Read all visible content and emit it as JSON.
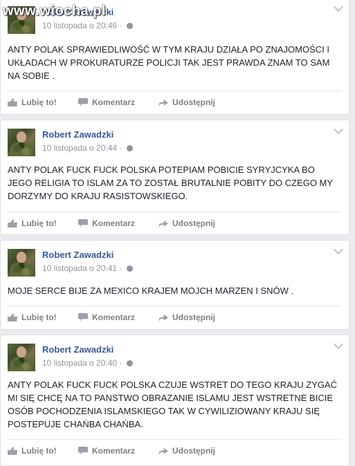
{
  "watermark": "www.wiocha.pl",
  "actions": {
    "like": "Lubię to!",
    "comment": "Komentarz",
    "share": "Udostępnij"
  },
  "posts": [
    {
      "author": "Robert Zawadzki",
      "time": "10 listopada o 20:46",
      "text": "ANTY POLAK SPRAWIEDLIWOŚĆ W TYM KRAJU DZIAŁA PO ZNAJOMOŚCI I UKŁADACH W PROKURATURZE POLICJI TAK JEST PRAWDA ZNAM TO SAM NA SOBIE ."
    },
    {
      "author": "Robert Zawadzki",
      "time": "10 listopada o 20:44",
      "text": "ANTY POLAK FUCK FUCK POLSKA POTEPIAM POBICIE SYRYJCYKA BO JEGO RELIGIA TO ISLAM ZA TO ZOSTAŁ BRUTALNIE POBITY DO CZEGO MY DORZYMY DO KRAJU RASISTOWSKIEGO."
    },
    {
      "author": "Robert Zawadzki",
      "time": "10 listopada o 20:41",
      "text": "MOJE SERCE BIJE ZA MEXICO KRAJEM MOJCH MARZEN I SNÓW ."
    },
    {
      "author": "Robert Zawadzki",
      "time": "10 listopada o 20:40",
      "text": "ANTY POLAK FUCK FUCK POLSKA CZUJE WSTRET DO TEGO KRAJU ZYGAĆ MI SIĘ CHCĘ NA TO PANSTWO OBRAZANIE ISLAMU JEST WSTRETNE BICIE OSÓB POCHODZENIA ISLAMSKIEGO TAK W CYWILIZIOWANY KRAJU SIĘ POSTEPUJE CHAŃBA CHAŃBA."
    }
  ]
}
